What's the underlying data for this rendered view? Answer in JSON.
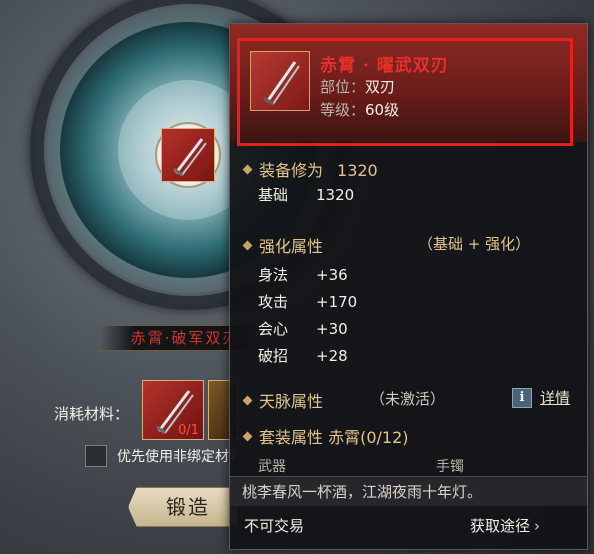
{
  "background": {
    "item_name": "赤霄·破军双刃",
    "materials_label": "消耗材料：",
    "material_count": "0/1",
    "checkbox_label": "优先使用非绑定材料",
    "forge_button": "锻造"
  },
  "tooltip": {
    "name": "赤霄 · 曜武双刃",
    "slot_key": "部位：",
    "slot_value": "双刃",
    "level_key": "等级：",
    "level_value": "60级",
    "gear_score": {
      "label": "装备修为",
      "value": "1320"
    },
    "base": {
      "label": "基础",
      "value": "1320"
    },
    "enhance": {
      "label": "强化属性",
      "aside": "（基础 + 强化）",
      "stats": [
        {
          "name": "身法",
          "value": "+36"
        },
        {
          "name": "攻击",
          "value": "+170"
        },
        {
          "name": "会心",
          "value": "+30"
        },
        {
          "name": "破招",
          "value": "+28"
        }
      ]
    },
    "meridian": {
      "label": "天脉属性",
      "status": "（未激活）",
      "info_icon": "i",
      "detail_link": "详情"
    },
    "set": {
      "label": "套装属性 赤霄(0/12)",
      "parts": [
        "武器",
        "手镯"
      ]
    },
    "flavor": "桃李春风一杯酒，江湖夜雨十年灯。",
    "tradable": "不可交易",
    "obtain": "获取途径",
    "obtain_arrow": "›"
  },
  "colors": {
    "accent_red": "#e6302a",
    "gold_label": "#e2c58c",
    "highlight_border": "#e8201b"
  },
  "icons": [
    "dual-blade-icon",
    "info-icon",
    "chevron-right-icon",
    "diamond-bullet-icon"
  ]
}
